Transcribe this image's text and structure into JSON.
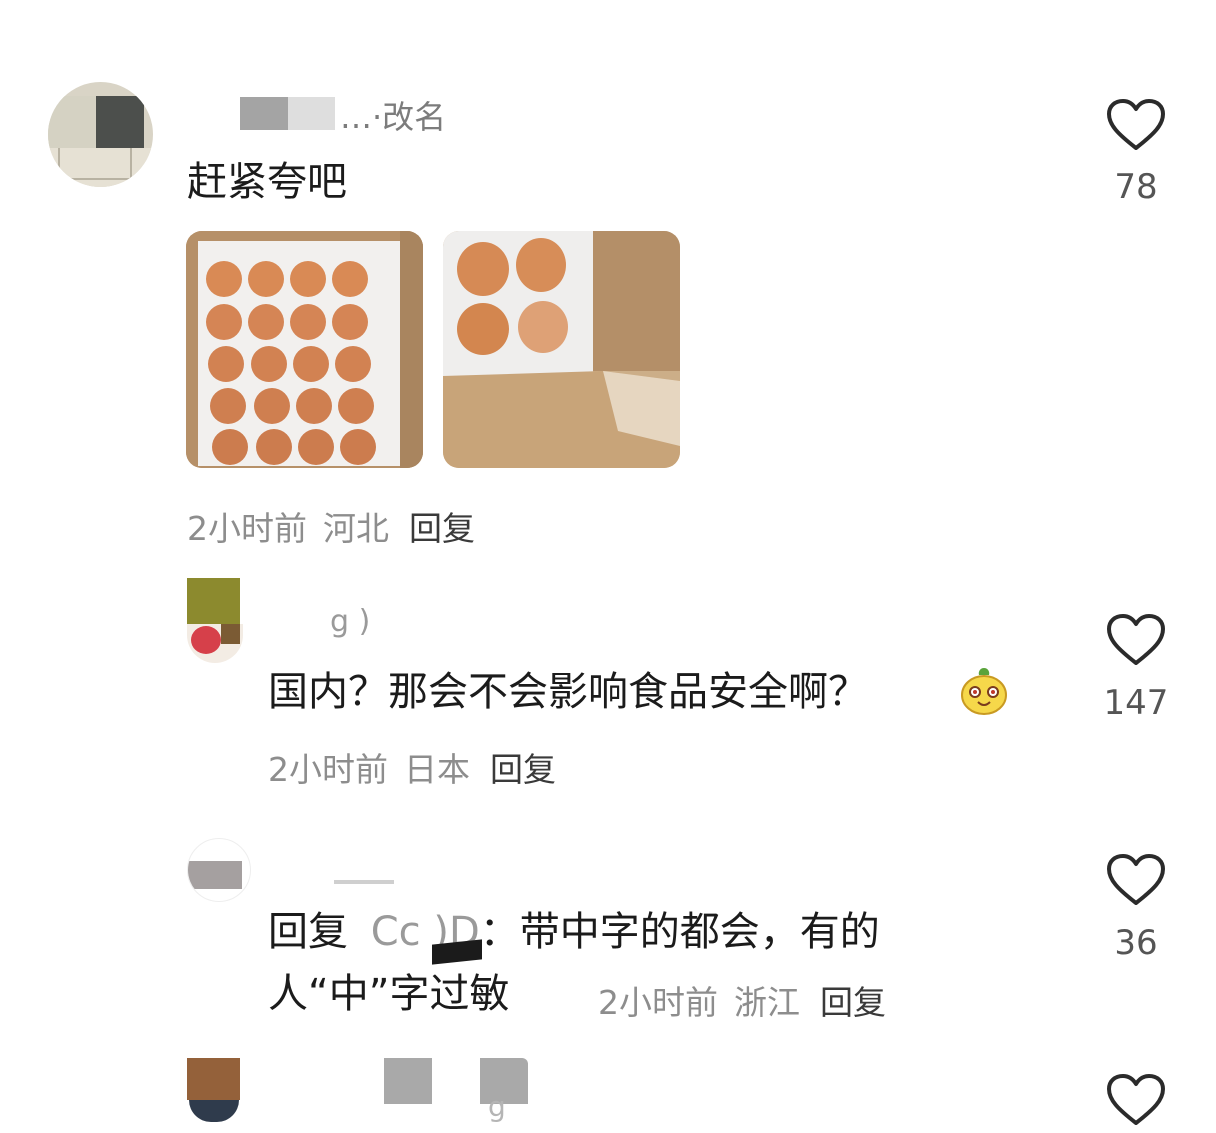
{
  "comments": [
    {
      "username": "…·改名",
      "text": "赶紧夸吧",
      "time": "2小时前",
      "location": "河北",
      "reply_label": "回复",
      "likes": "78",
      "images": [
        "eggs-tray-photo",
        "eggs-box-photo"
      ]
    },
    {
      "username": "g )",
      "text": "国内？那会不会影响食品安全啊？",
      "emoji": "smiling-pear-emoji",
      "time": "2小时前",
      "location": "日本",
      "reply_label": "回复",
      "likes": "147"
    },
    {
      "username": "",
      "reply_prefix": "回复",
      "reply_to": "Cc   )D",
      "text_line1": "：带中字的都会，有的",
      "text_line2": "人“中”字过敏",
      "time": "2小时前",
      "location": "浙江",
      "reply_label": "回复",
      "likes": "36"
    },
    {
      "username": "g",
      "likes": ""
    }
  ],
  "colors": {
    "like_outline": "#2b2b2b",
    "meta": "#8d8d8d"
  }
}
